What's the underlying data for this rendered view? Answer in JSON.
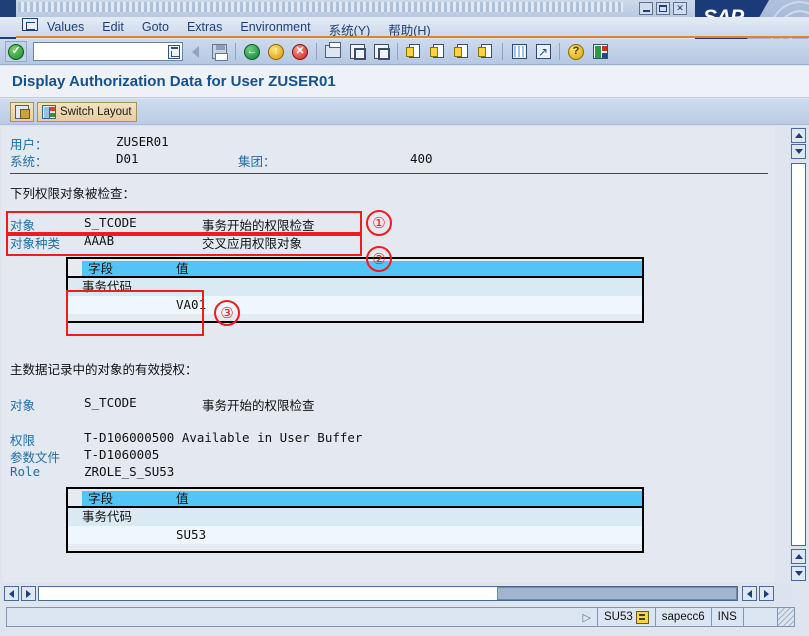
{
  "window": {
    "sap_logo_text": "SAP",
    "controls": [
      "minimize",
      "maximize",
      "close"
    ],
    "system_menu_icon": "system-menu-icon"
  },
  "menubar": {
    "items": [
      {
        "label": "Values",
        "accel": "a"
      },
      {
        "label": "Edit",
        "accel": "E"
      },
      {
        "label": "Goto",
        "accel": "G"
      },
      {
        "label": "Extras",
        "accel": "a"
      },
      {
        "label": "Environment",
        "accel": "i"
      },
      {
        "label": "系统(Y)",
        "accel": "Y"
      },
      {
        "label": "帮助(H)",
        "accel": "H"
      }
    ]
  },
  "toolbar": {
    "enter_icon": "enter-check-icon",
    "command_field_value": "",
    "command_field_placeholder": "",
    "command_dropdown_icon": "chevron-down-icon",
    "icons": [
      "back-arrow-icon",
      "save-icon",
      "back-green-icon",
      "exit-yellow-icon",
      "cancel-red-icon",
      "print-icon",
      "find-icon",
      "find-next-icon",
      "first-page-icon",
      "previous-page-icon",
      "next-page-icon",
      "last-page-icon",
      "grid-icon",
      "export-icon",
      "help-icon",
      "layout-menu-icon"
    ]
  },
  "page": {
    "title": "Display Authorization Data for User ZUSER01"
  },
  "apptoolbar": {
    "buttons": [
      {
        "label": "",
        "icon": "new-window-icon"
      },
      {
        "label": "Switch Layout",
        "icon": "switch-layout-icon"
      }
    ]
  },
  "header_fields": {
    "user_label": "用户：",
    "user_value": "ZUSER01",
    "system_label": "系统：",
    "system_value": "D01",
    "client_label": "集团：",
    "client_value": "400"
  },
  "section_checked": {
    "heading": "下列权限对象被检查：",
    "rows": [
      {
        "label": "对象",
        "code": "S_TCODE",
        "text": "事务开始的权限检查"
      },
      {
        "label": "对象种类",
        "code": "AAAB",
        "text": "交叉应用权限对象"
      }
    ],
    "table": {
      "headers": [
        "字段",
        "值"
      ],
      "rows": [
        {
          "field": "事务代码",
          "value": "VA01"
        }
      ]
    }
  },
  "section_master": {
    "heading": "主数据记录中的对象的有效授权：",
    "rows": [
      {
        "label": "对象",
        "code": "S_TCODE",
        "text": "事务开始的权限检查"
      }
    ],
    "details": [
      {
        "label": "权限",
        "value": "T-D106000500 Available in User Buffer"
      },
      {
        "label": "参数文件",
        "value": "T-D1060005"
      },
      {
        "label": "Role",
        "value": "ZROLE_S_SU53"
      }
    ],
    "table": {
      "headers": [
        "字段",
        "值"
      ],
      "rows": [
        {
          "field": "事务代码",
          "value": "SU53"
        }
      ]
    }
  },
  "annotations": [
    {
      "id": "1",
      "marker": "①"
    },
    {
      "id": "2",
      "marker": "②"
    },
    {
      "id": "3",
      "marker": "③"
    }
  ],
  "statusbar": {
    "message": "",
    "expand_icon": "expand-triangle-icon",
    "transaction": "SU53",
    "transaction_icon": "transaction-icon",
    "system": "sapecc6",
    "insert_mode": "INS",
    "extra": ""
  },
  "colors": {
    "accent_orange": "#e8821e",
    "title_blue": "#13518f",
    "label_blue": "#1c6ea8",
    "table_header_cyan": "#52c5f8",
    "annotation_red": "#ee1c1c",
    "sap_navy": "#1b3a78"
  }
}
